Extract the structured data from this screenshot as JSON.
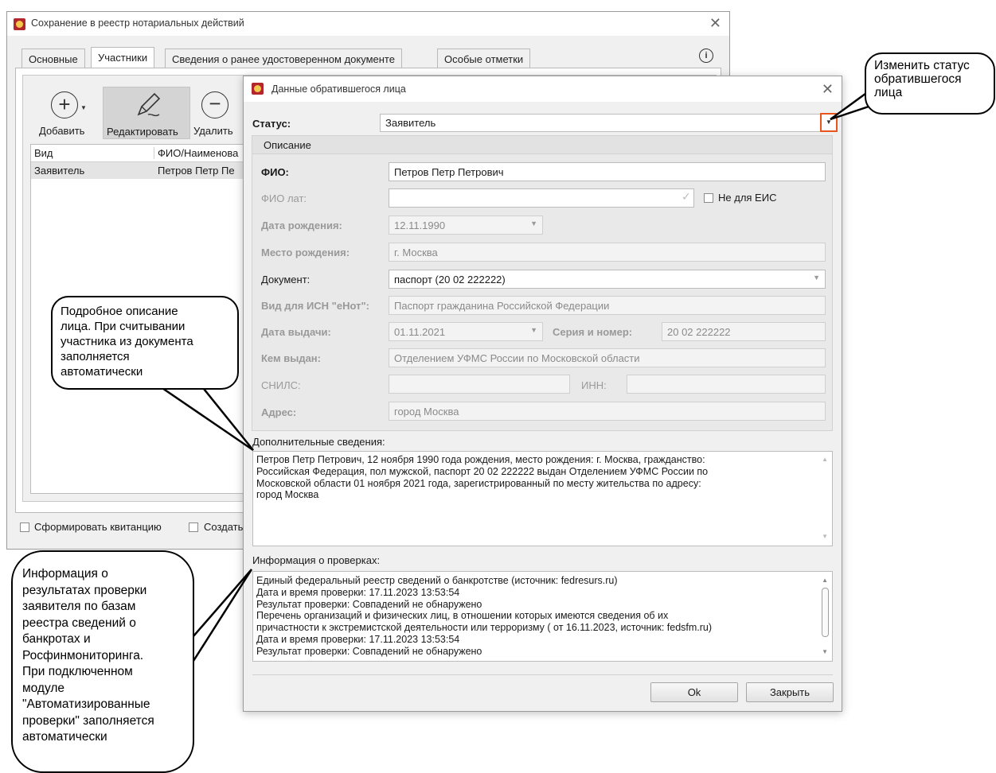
{
  "main_window": {
    "title": "Сохранение в реестр нотариальных действий",
    "tabs": [
      "Основные",
      "Участники",
      "Сведения о ранее удостоверенном документе",
      "Особые отметки"
    ],
    "active_tab": "Участники",
    "toolbar": {
      "add_label": "Добавить",
      "edit_label": "Редактировать",
      "delete_label": "Удалить"
    },
    "table": {
      "headers": [
        "Вид",
        "ФИО/Наименова"
      ],
      "rows": [
        [
          "Заявитель",
          "Петров Петр Пе"
        ]
      ]
    },
    "bottom": {
      "receipt_label": "Сформировать квитанцию",
      "create_label": "Создать"
    }
  },
  "dialog": {
    "title": "Данные обратившегося лица",
    "status_label": "Статус:",
    "status_value": "Заявитель",
    "section_title": "Описание",
    "fio_label": "ФИО:",
    "fio_value": "Петров Петр Петрович",
    "fio_lat_label": "ФИО лат:",
    "fio_lat_value": "",
    "not_eis_label": "Не для ЕИС",
    "birth_date_label": "Дата рождения:",
    "birth_date_value": "12.11.1990",
    "birth_place_label": "Место рождения:",
    "birth_place_value": "г. Москва",
    "document_label": "Документ:",
    "document_value": "паспорт (20 02 222222)",
    "enot_label": "Вид для ИСН \"еНот\":",
    "enot_value": "Паспорт гражданина Российской Федерации",
    "issue_date_label": "Дата выдачи:",
    "issue_date_value": "01.11.2021",
    "series_label": "Серия и номер:",
    "series_value": "20 02 222222",
    "issued_by_label": "Кем выдан:",
    "issued_by_value": "Отделением УФМС России по Московской области",
    "snils_label": "СНИЛС:",
    "snils_value": "",
    "inn_label": "ИНН:",
    "inn_value": "",
    "address_label": "Адрес:",
    "address_value": "город Москва",
    "additional_label": "Дополнительные сведения:",
    "additional_lines": [
      "Петров Петр Петрович, 12 ноября 1990 года рождения, место рождения: г. Москва, гражданство:",
      "Российская Федерация, пол мужской, паспорт 20 02 222222 выдан Отделением УФМС России по",
      "Московской области 01 ноября 2021 года, зарегистрированный по месту жительства по адресу:",
      "город Москва"
    ],
    "checks_label": "Информация о проверках:",
    "checks_lines": [
      "Единый федеральный реестр сведений о банкротстве (источник: fedresurs.ru)",
      "Дата и время проверки: 17.11.2023 13:53:54",
      "Результат проверки: Совпадений не обнаружено",
      "Перечень организаций и физических лиц, в отношении которых имеются сведения об их",
      "причастности к экстремистской деятельности или терроризму ( от 16.11.2023, источник: fedsfm.ru)",
      "Дата и время проверки: 17.11.2023 13:53:54",
      "Результат проверки: Совпадений не обнаружено"
    ],
    "ok_label": "Ok",
    "close_label": "Закрыть"
  },
  "callouts": {
    "status_note": [
      "Изменить статус",
      "обратившегося",
      "лица"
    ],
    "description_note": [
      "Подробное описание",
      "лица. При считывании",
      "участника из документа",
      "заполняется",
      "автоматически"
    ],
    "checks_note": [
      "Информация о",
      "результатах проверки",
      "заявителя по базам",
      "реестра сведений о",
      "банкротах и",
      "Росфинмониторинга.",
      "При подключенном",
      "модуле",
      "\"Автоматизированные",
      "проверки\" заполняется",
      "автоматически"
    ]
  },
  "colors": {
    "accent_orange": "#e8551d",
    "logo_red": "#b3262c"
  }
}
